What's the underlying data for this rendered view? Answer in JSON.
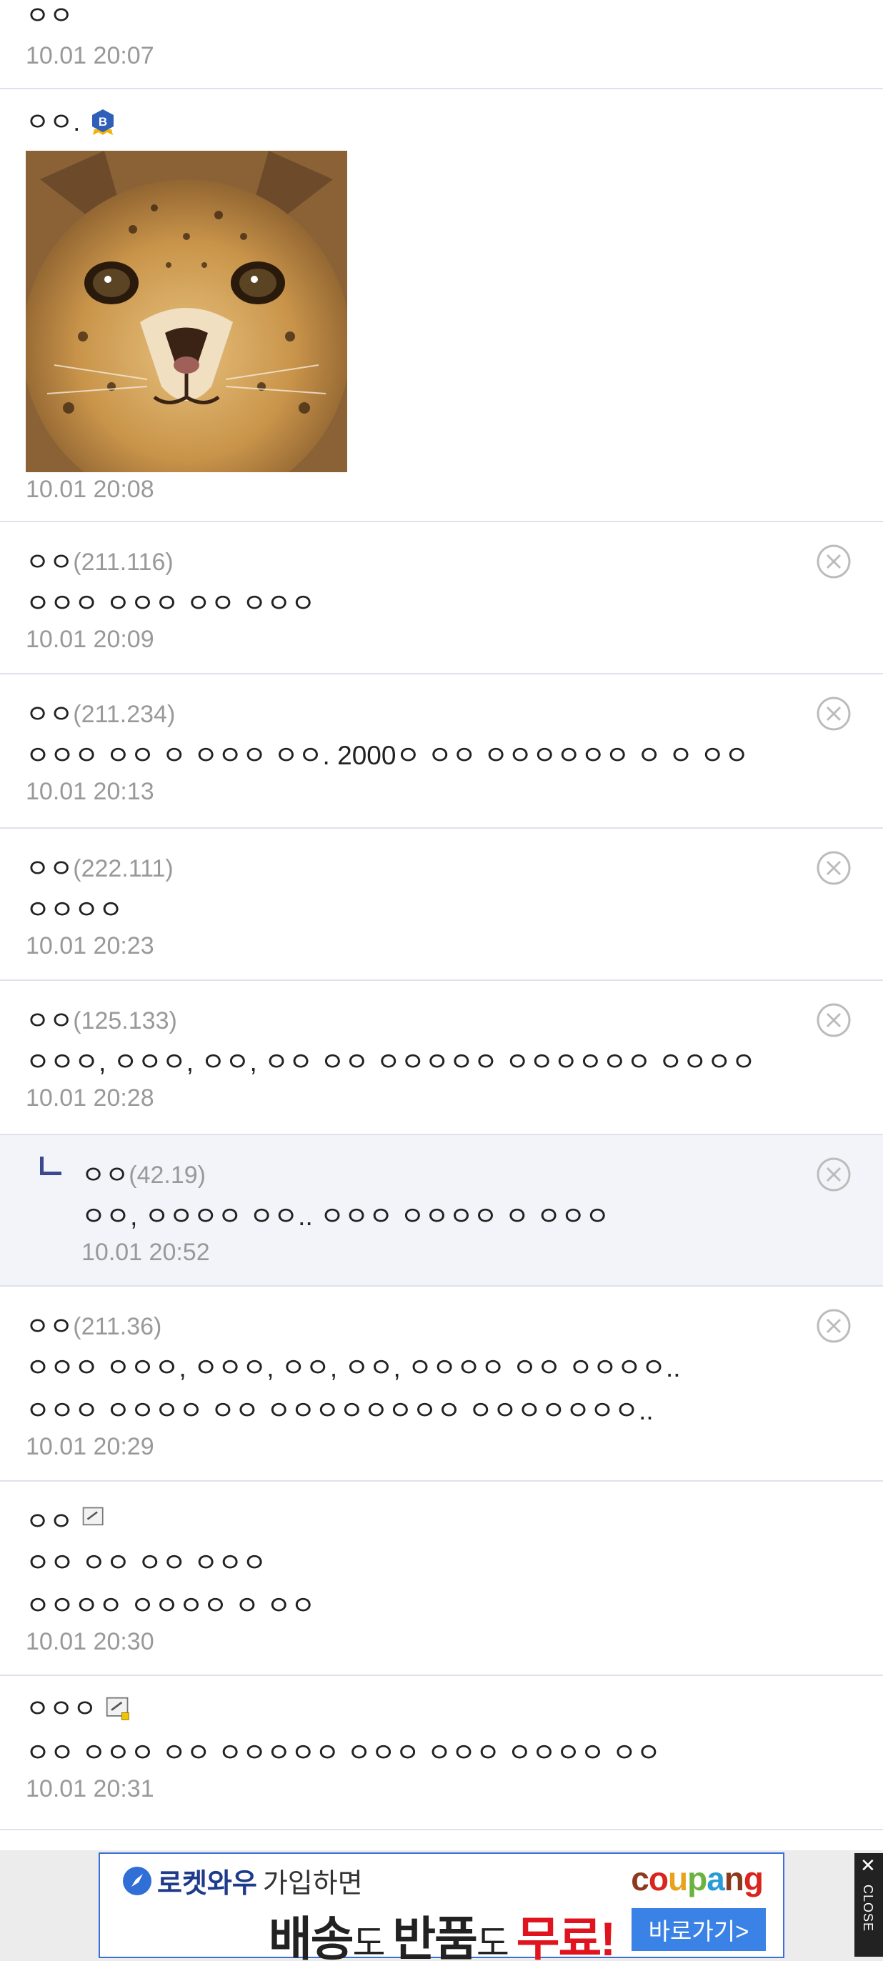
{
  "comments": [
    {
      "nick": "ㅇㅇ",
      "ip": "",
      "badge": "",
      "text": [],
      "date": "10.01 20:07",
      "deletable": false,
      "reply": false,
      "image": false
    },
    {
      "nick": "ㅇㅇ.",
      "ip": "",
      "badge": "b-badge-icon",
      "text": [],
      "date": "10.01 20:08",
      "deletable": false,
      "reply": false,
      "image": true
    },
    {
      "nick": "ㅇㅇ",
      "ip": "(211.116)",
      "badge": "",
      "text": [
        "ㅇㅇㅇ ㅇㅇㅇ ㅇㅇ ㅇㅇㅇ"
      ],
      "date": "10.01 20:09",
      "deletable": true,
      "reply": false,
      "image": false
    },
    {
      "nick": "ㅇㅇ",
      "ip": "(211.234)",
      "badge": "",
      "text": [
        "ㅇㅇㅇ ㅇㅇ ㅇ ㅇㅇㅇ ㅇㅇ. 2000ㅇ ㅇㅇ ㅇㅇㅇㅇㅇㅇ ㅇ ㅇ ㅇㅇ"
      ],
      "date": "10.01 20:13",
      "deletable": true,
      "reply": false,
      "image": false
    },
    {
      "nick": "ㅇㅇ",
      "ip": "(222.111)",
      "badge": "",
      "text": [
        "ㅇㅇㅇㅇ"
      ],
      "date": "10.01 20:23",
      "deletable": true,
      "reply": false,
      "image": false
    },
    {
      "nick": "ㅇㅇ",
      "ip": "(125.133)",
      "badge": "",
      "text": [
        "ㅇㅇㅇ, ㅇㅇㅇ, ㅇㅇ, ㅇㅇ ㅇㅇ ㅇㅇㅇㅇㅇ ㅇㅇㅇㅇㅇㅇ ㅇㅇㅇㅇ"
      ],
      "date": "10.01 20:28",
      "deletable": true,
      "reply": false,
      "image": false
    },
    {
      "nick": "ㅇㅇ",
      "ip": "(42.19)",
      "badge": "",
      "text": [
        "ㅇㅇ, ㅇㅇㅇㅇ ㅇㅇ.. ㅇㅇㅇ ㅇㅇㅇㅇ ㅇ ㅇㅇㅇ"
      ],
      "date": "10.01 20:52",
      "deletable": true,
      "reply": true,
      "image": false
    },
    {
      "nick": "ㅇㅇ",
      "ip": "(211.36)",
      "badge": "",
      "text": [
        "ㅇㅇㅇ ㅇㅇㅇ, ㅇㅇㅇ, ㅇㅇ, ㅇㅇ, ㅇㅇㅇㅇ ㅇㅇ ㅇㅇㅇㅇ..",
        "ㅇㅇㅇ ㅇㅇㅇㅇ ㅇㅇ ㅇㅇㅇㅇㅇㅇㅇㅇ ㅇㅇㅇㅇㅇㅇㅇ.."
      ],
      "date": "10.01 20:29",
      "deletable": true,
      "reply": false,
      "image": false
    },
    {
      "nick": "ㅇㅇ",
      "ip": "",
      "badge": "gallog-icon",
      "text": [
        "ㅇㅇ ㅇㅇ ㅇㅇ ㅇㅇㅇ",
        "ㅇㅇㅇㅇ ㅇㅇㅇㅇ ㅇ ㅇㅇ"
      ],
      "date": "10.01 20:30",
      "deletable": false,
      "reply": false,
      "image": false
    },
    {
      "nick": "ㅇㅇㅇ",
      "ip": "",
      "badge": "gallog-fixed-icon",
      "text": [
        "ㅇㅇ ㅇㅇㅇ ㅇㅇ ㅇㅇㅇㅇㅇ ㅇㅇㅇ ㅇㅇㅇ ㅇㅇㅇㅇ ㅇㅇ"
      ],
      "date": "10.01 20:31",
      "deletable": false,
      "reply": false,
      "image": false
    }
  ],
  "ad": {
    "brand_line": "로켓와우",
    "brand_line_rest": "가입하면",
    "headline_1": "배송",
    "headline_2": "도 ",
    "headline_3": "반품",
    "headline_4": "도 ",
    "headline_5": "무료!",
    "logo": "coupang",
    "button": "바로가기>",
    "close": "CLOSE",
    "close_x": "✕"
  }
}
